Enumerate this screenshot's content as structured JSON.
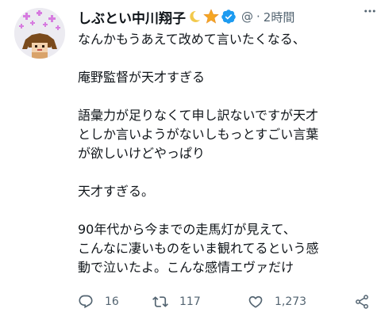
{
  "tweet": {
    "display_name": "しぶとい中川翔子",
    "handle": "@",
    "separator": "·",
    "time": "2時間",
    "lines": [
      "なんかもうあえて改めて言いたくなる、",
      "",
      "庵野監督が天才すぎる",
      "",
      "語彙力が足りなくて申し訳ないですが天才",
      "としか言いようがないしもっとすごい言葉",
      "が欲しいけどやっぱり",
      "",
      "天才すぎる。",
      "",
      "90年代から今までの走馬灯が見えて、",
      "こんなに凄いものをいま観れてるという感",
      "動で泣いたよ。こんな感情エヴァだけ"
    ]
  },
  "actions": {
    "reply_count": "16",
    "retweet_count": "117",
    "like_count": "1,273"
  },
  "colors": {
    "text": "#0f1419",
    "secondary": "#536471",
    "verified": "#1d9bf0",
    "star": "#f5a623",
    "moon": "#f2c94c"
  },
  "icons": [
    "moon-emoji-icon",
    "star-emoji-icon",
    "verified-badge-icon",
    "more-options-icon",
    "reply-icon",
    "retweet-icon",
    "like-icon",
    "share-icon"
  ]
}
